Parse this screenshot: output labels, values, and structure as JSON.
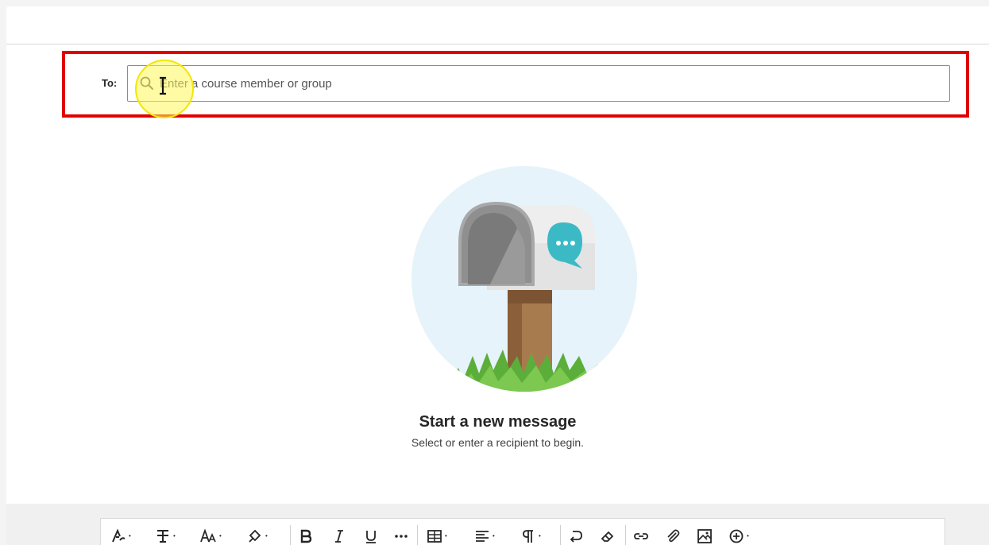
{
  "compose": {
    "to_label": "To:",
    "to_placeholder": "Enter a course member or group",
    "to_value": ""
  },
  "empty_state": {
    "title": "Start a new message",
    "subtitle": "Select or enter a recipient to begin."
  },
  "toolbar": {
    "icons": [
      "paragraph-style-icon",
      "text-style-icon",
      "font-size-icon",
      "highlight-color-icon",
      "bold-icon",
      "italic-icon",
      "underline-icon",
      "more-formatting-icon",
      "table-icon",
      "align-icon",
      "paragraph-mark-icon",
      "undo-icon",
      "clear-formatting-icon",
      "link-icon",
      "attach-icon",
      "image-icon",
      "insert-content-icon"
    ]
  },
  "colors": {
    "highlight_border": "#e00000",
    "cursor_highlight": "#fff55a",
    "illustration_bg": "#e6f3fb",
    "chat_bubble": "#3bbac6"
  }
}
